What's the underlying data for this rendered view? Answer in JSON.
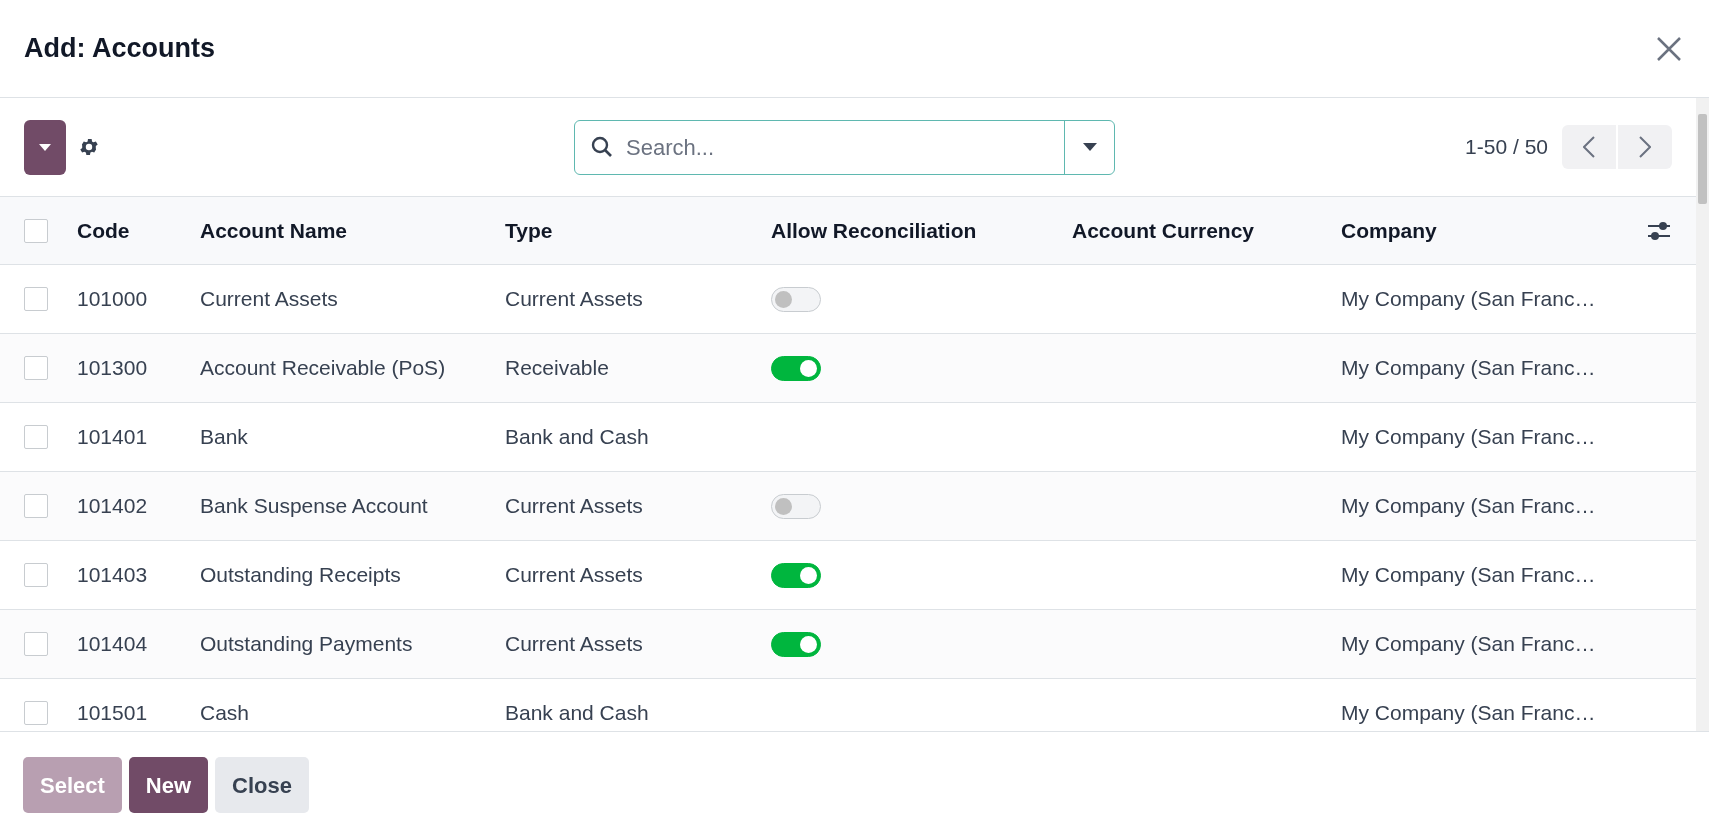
{
  "dialog": {
    "title": "Add: Accounts"
  },
  "search": {
    "placeholder": "Search..."
  },
  "pager": {
    "text": "1-50 / 50"
  },
  "table": {
    "columns": [
      "Code",
      "Account Name",
      "Type",
      "Allow Reconciliation",
      "Account Currency",
      "Company"
    ],
    "select_all": {
      "checked": false
    },
    "rows": [
      {
        "checked": false,
        "code": "101000",
        "name": "Current Assets",
        "type": "Current Assets",
        "reconcile": {
          "on": false
        },
        "company": "My Company (San Franc…"
      },
      {
        "checked": false,
        "code": "101300",
        "name": "Account Receivable (PoS)",
        "type": "Receivable",
        "reconcile": {
          "on": true
        },
        "company": "My Company (San Franc…"
      },
      {
        "checked": false,
        "code": "101401",
        "name": "Bank",
        "type": "Bank and Cash",
        "company": "My Company (San Franc…"
      },
      {
        "checked": false,
        "code": "101402",
        "name": "Bank Suspense Account",
        "type": "Current Assets",
        "reconcile": {
          "on": false
        },
        "company": "My Company (San Franc…"
      },
      {
        "checked": false,
        "code": "101403",
        "name": "Outstanding Receipts",
        "type": "Current Assets",
        "reconcile": {
          "on": true
        },
        "company": "My Company (San Franc…"
      },
      {
        "checked": false,
        "code": "101404",
        "name": "Outstanding Payments",
        "type": "Current Assets",
        "reconcile": {
          "on": true
        },
        "company": "My Company (San Franc…"
      },
      {
        "checked": false,
        "code": "101501",
        "name": "Cash",
        "type": "Bank and Cash",
        "company": "My Company (San Franc…"
      }
    ]
  },
  "footer": {
    "buttons": [
      {
        "label": "Select",
        "kind": "primary",
        "disabled": true
      },
      {
        "label": "New",
        "kind": "primary",
        "disabled": false
      },
      {
        "label": "Close",
        "kind": "secondary",
        "disabled": false
      }
    ]
  }
}
